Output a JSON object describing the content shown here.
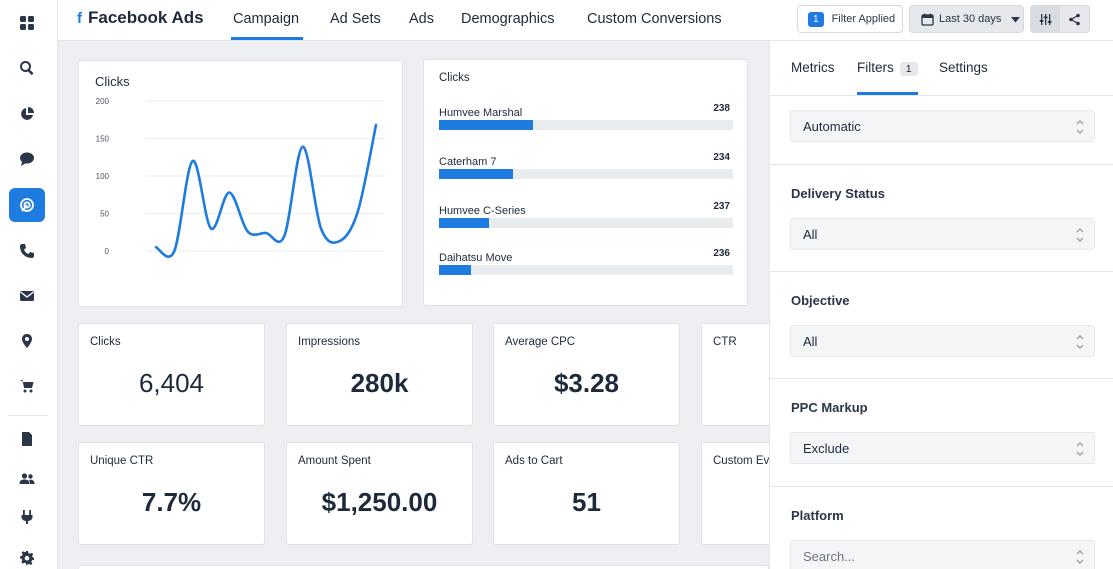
{
  "app": {
    "title": "Facebook Ads",
    "brand_icon": "facebook-icon"
  },
  "tabs": [
    {
      "label": "Campaign",
      "active": true
    },
    {
      "label": "Ad Sets"
    },
    {
      "label": "Ads"
    },
    {
      "label": "Demographics"
    },
    {
      "label": "Custom Conversions"
    }
  ],
  "toolbar": {
    "filter_count": "1",
    "filter_label": "Filter Applied",
    "date_label": "Last 30 days",
    "icons": [
      "calendar-icon",
      "chevron-down-icon",
      "sliders-icon",
      "share-icon"
    ]
  },
  "rail": [
    "grid-icon",
    "search-icon",
    "pie-chart-icon",
    "chat-icon",
    "ppc-icon",
    "phone-icon",
    "mail-icon",
    "location-pin-icon",
    "cart-icon",
    "document-icon",
    "users-icon",
    "plug-icon",
    "gear-icon"
  ],
  "line_card": {
    "title": "Clicks"
  },
  "chart_data": {
    "type": "line",
    "title": "Clicks",
    "y_ticks": [
      0,
      50,
      100,
      150,
      200
    ],
    "ylim": [
      0,
      200
    ],
    "values": [
      5,
      0,
      120,
      30,
      78,
      26,
      24,
      20,
      139,
      30,
      13,
      52,
      168
    ],
    "color": "#1e7be0",
    "grid": true
  },
  "bars_card": {
    "title": "Clicks",
    "rows": [
      {
        "name": "Humvee Marshal",
        "value": "238",
        "fill": 0.32
      },
      {
        "name": "Caterham 7",
        "value": "234",
        "fill": 0.25
      },
      {
        "name": "Humvee C-Series",
        "value": "237",
        "fill": 0.17
      },
      {
        "name": "Daihatsu Move",
        "value": "236",
        "fill": 0.11
      }
    ]
  },
  "stats": [
    {
      "label": "Clicks",
      "value": "6,404"
    },
    {
      "label": "Impressions",
      "value": "280k"
    },
    {
      "label": "Average CPC",
      "value": "$3.28"
    },
    {
      "label": "CTR",
      "value": ""
    },
    {
      "label": "Unique CTR",
      "value": "7.7%"
    },
    {
      "label": "Amount Spent",
      "value": "$1,250.00"
    },
    {
      "label": "Ads to Cart",
      "value": "51"
    },
    {
      "label": "Custom Ev",
      "value": ""
    }
  ],
  "panel": {
    "tabs": [
      {
        "label": "Metrics"
      },
      {
        "label": "Filters",
        "badge": "1",
        "active": true
      },
      {
        "label": "Settings"
      }
    ],
    "first_select": "Automatic",
    "sections": [
      {
        "label": "Delivery Status",
        "value": "All"
      },
      {
        "label": "Objective",
        "value": "All"
      },
      {
        "label": "PPC Markup",
        "value": "Exclude"
      },
      {
        "label": "Platform",
        "placeholder": "Search..."
      }
    ]
  },
  "colors": {
    "accent": "#1e7be0",
    "background": "#edeff2"
  }
}
